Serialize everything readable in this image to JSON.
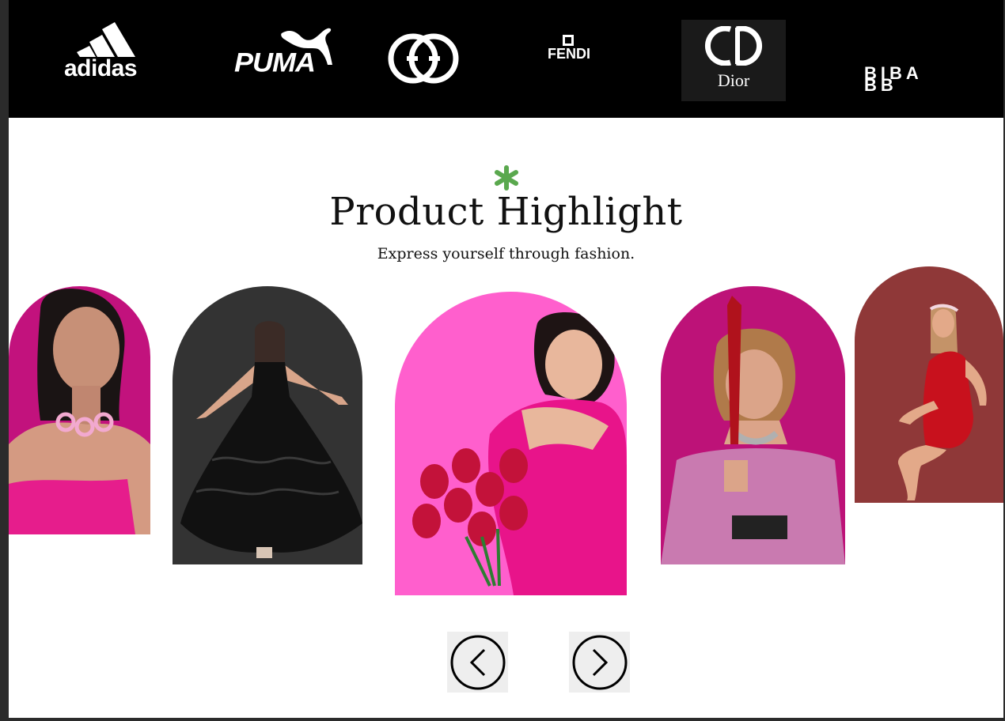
{
  "brands": {
    "adidas": "adidas",
    "puma": "PUMA",
    "gucci": "gucci-logo",
    "fendi": "FENDI",
    "dior": "Dior",
    "biba_mark": "BB",
    "biba": "BIBA"
  },
  "section": {
    "title": "Product Highlight",
    "subtitle": "Express yourself through fashion.",
    "accent_color": "#5aa84e"
  },
  "products": [
    {
      "name": "model-pink-strapless",
      "bg": "#c2127d"
    },
    {
      "name": "model-black-gown",
      "bg": "#333333"
    },
    {
      "name": "model-pink-dress-tulips",
      "bg": "#ff5fcd"
    },
    {
      "name": "model-pink-offshoulder-sword",
      "bg": "#bd1278"
    },
    {
      "name": "model-red-dress",
      "bg": "#8f3838"
    }
  ],
  "navigation": {
    "prev_icon": "chevron-left-icon",
    "next_icon": "chevron-right-icon"
  }
}
